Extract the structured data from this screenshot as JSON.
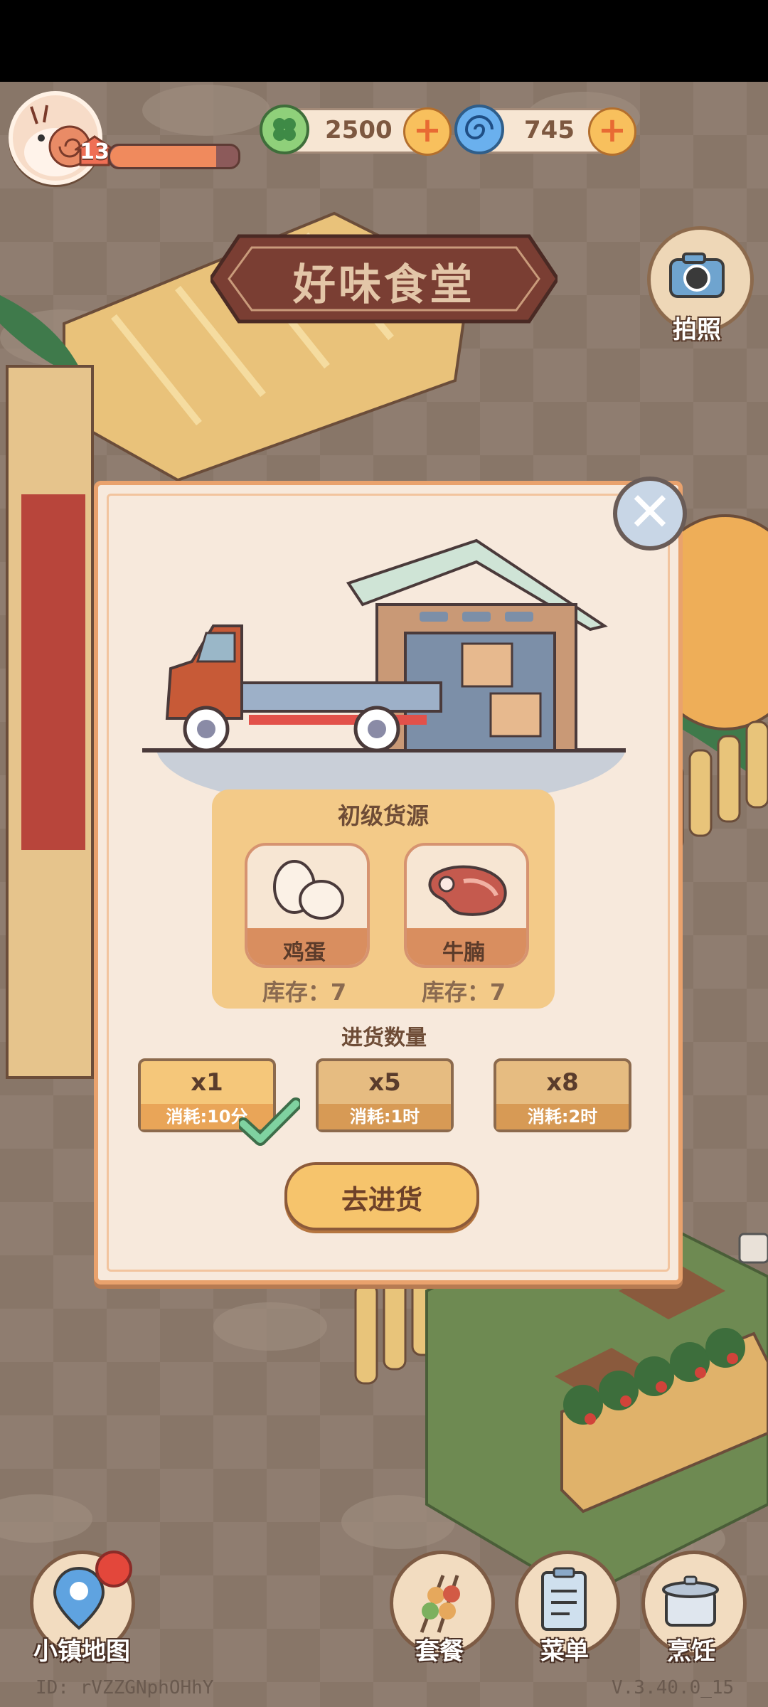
{
  "header": {
    "level": "13",
    "xp_fraction": 0.83,
    "currencies": [
      {
        "icon": "clover-coin-icon",
        "amount": "2500"
      },
      {
        "icon": "blue-swirl-gem-icon",
        "amount": "745"
      }
    ]
  },
  "restaurant_name": "好味食堂",
  "camera_label": "拍照",
  "dialog": {
    "source_title": "初级货源",
    "items": [
      {
        "name": "鸡蛋",
        "stock": "库存：7",
        "icon": "eggs-icon"
      },
      {
        "name": "牛腩",
        "stock": "库存：7",
        "icon": "steak-icon"
      }
    ],
    "quantity_label": "进货数量",
    "options": [
      {
        "label": "x1",
        "cost": "消耗:10分",
        "selected": true
      },
      {
        "label": "x5",
        "cost": "消耗:1时",
        "selected": false
      },
      {
        "label": "x8",
        "cost": "消耗:2时",
        "selected": false
      }
    ],
    "confirm_label": "去进货"
  },
  "bottom_nav": {
    "map": "小镇地图",
    "combo": "套餐",
    "menu": "菜单",
    "cook": "烹饪"
  },
  "footer": {
    "id": "ID:  rVZZGNphOHhY",
    "version": "V.3.40.0_15"
  },
  "colors": {
    "panel": "#f7e9dc",
    "border": "#e9a26d",
    "accent": "#f6c46c"
  }
}
